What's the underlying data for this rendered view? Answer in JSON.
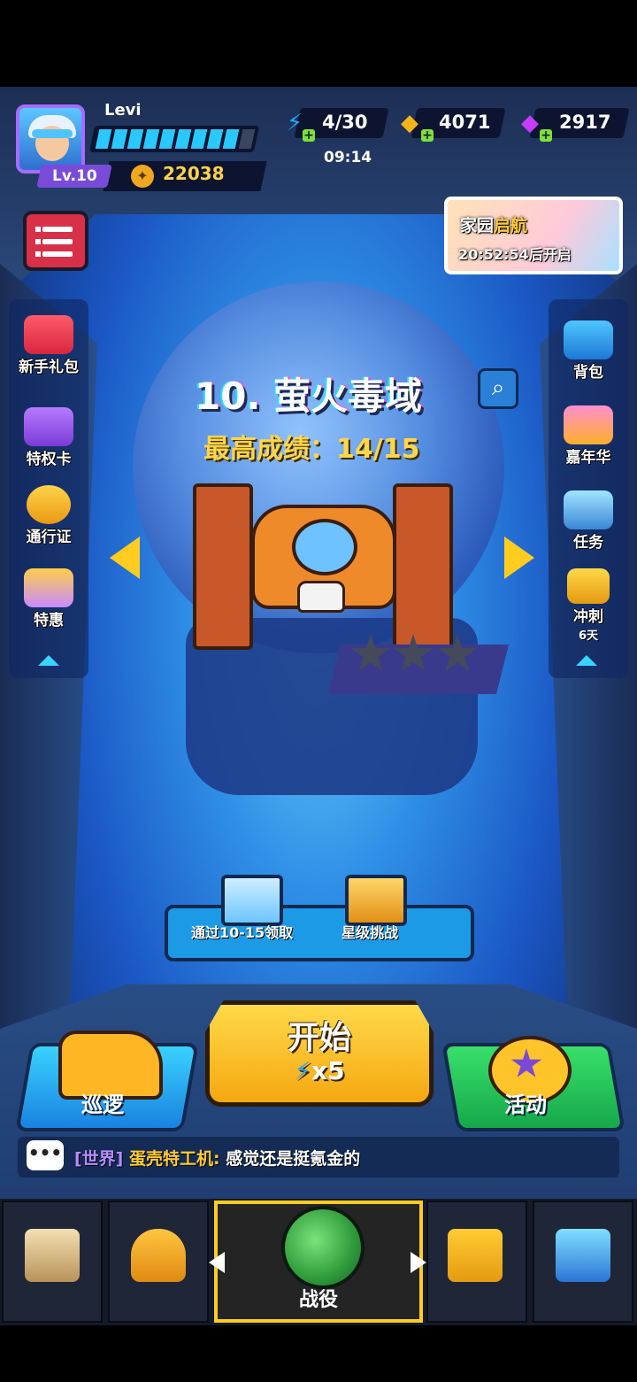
{
  "player": {
    "name": "Levi",
    "level_label": "Lv.10",
    "power": "22038",
    "xp_fraction": 0.85
  },
  "resources": {
    "energy": "4/30",
    "energy_timer": "09:14",
    "gold": "4071",
    "gems": "2917"
  },
  "home_event": {
    "title_part1": "家园",
    "title_part2": "启航",
    "countdown": "20:52:54后开启"
  },
  "left_menu": [
    {
      "label": "新手礼包",
      "icon": "gift-box-icon"
    },
    {
      "label": "特权卡",
      "icon": "privilege-card-icon"
    },
    {
      "label": "通行证",
      "icon": "battle-pass-icon"
    },
    {
      "label": "特惠",
      "icon": "special-offer-icon"
    }
  ],
  "right_menu": [
    {
      "label": "背包",
      "icon": "backpack-icon"
    },
    {
      "label": "嘉年华",
      "icon": "carnival-icon"
    },
    {
      "label": "任务",
      "icon": "task-icon"
    },
    {
      "label": "冲刺",
      "sub": "6天",
      "icon": "trophy-icon"
    }
  ],
  "stage": {
    "title": "10. 萤火毒域",
    "best_score": "最高成绩：14/15",
    "stars_earned": 0,
    "stars_total": 3
  },
  "rewards": {
    "clear_reward_label": "通过10-15领取",
    "star_challenge_label": "星级挑战"
  },
  "actions": {
    "start_label": "开始",
    "start_cost": "x5",
    "patrol_label": "巡逻",
    "event_label": "活动"
  },
  "chat": {
    "channel": "[世界]",
    "user": "蛋壳特工机:",
    "message": "感觉还是挺氪金的"
  },
  "bottom_nav": {
    "active_label": "战役"
  },
  "colors": {
    "accent_yellow": "#ffcc1f",
    "energy_blue": "#29c8ff",
    "gem_purple": "#c43cff"
  }
}
